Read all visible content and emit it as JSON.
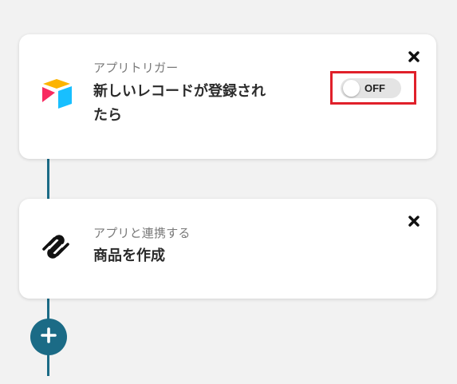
{
  "flow": {
    "steps": [
      {
        "label": "アプリトリガー",
        "title": "新しいレコードが登録されたら",
        "app_icon": "airtable-icon",
        "toggle_label": "OFF",
        "close_icon": "close-icon"
      },
      {
        "label": "アプリと連携する",
        "title": "商品を作成",
        "app_icon": "squarespace-icon",
        "close_icon": "close-icon"
      }
    ],
    "add_step_icon": "plus-icon"
  },
  "colors": {
    "connector": "#1b6b86",
    "add_button": "#1b6b86",
    "highlight": "#e0202a",
    "toggle_track": "#e4e4e4",
    "airtable_yellow": "#fcb400",
    "airtable_red": "#f82b60",
    "airtable_blue": "#18bfff"
  }
}
